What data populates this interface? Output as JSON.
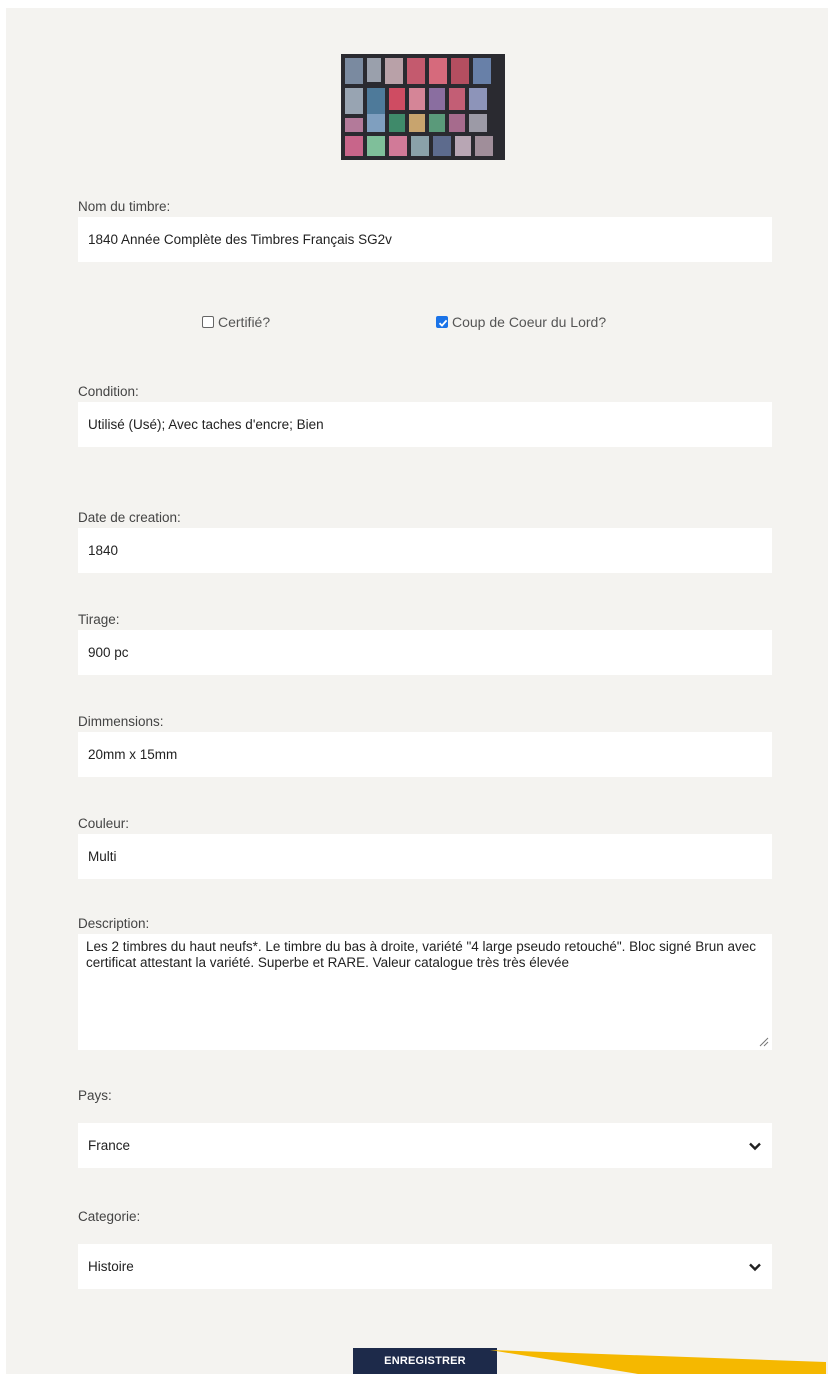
{
  "form": {
    "name_label": "Nom du timbre:",
    "name_value": "1840 Année Complète des Timbres Français SG2v",
    "certified_label": "Certifié?",
    "certified_checked": false,
    "favorite_label": "Coup de Coeur du Lord?",
    "favorite_checked": true,
    "condition_label": "Condition:",
    "condition_value": "Utilisé (Usé);  Avec taches d'encre; Bien",
    "date_label": "Date de creation:",
    "date_value": "1840",
    "print_run_label": "Tirage:",
    "print_run_value": "900 pc",
    "dimensions_label": "Dimmensions:",
    "dimensions_value": "20mm x 15mm",
    "color_label": "Couleur:",
    "color_value": "Multi",
    "description_label": "Description:",
    "description_value": "Les 2 timbres du haut neufs*. Le timbre du bas à droite, variété \"4 large pseudo retouché\". Bloc signé Brun avec certificat attestant la variété. Superbe et RARE. Valeur catalogue très très élevée",
    "country_label": "Pays:",
    "country_value": "France",
    "category_label": "Categorie:",
    "category_value": "Histoire",
    "save_label": "ENREGISTRER"
  },
  "colors": {
    "background": "#f4f3f0",
    "button": "#1d2a4a",
    "checkbox_accent": "#1a73e8",
    "annotation_arrow": "#f5b800"
  },
  "icons": {
    "image": "stamp-collection-image",
    "select_arrow": "chevron-down-icon",
    "resize": "resize-handle-icon"
  }
}
